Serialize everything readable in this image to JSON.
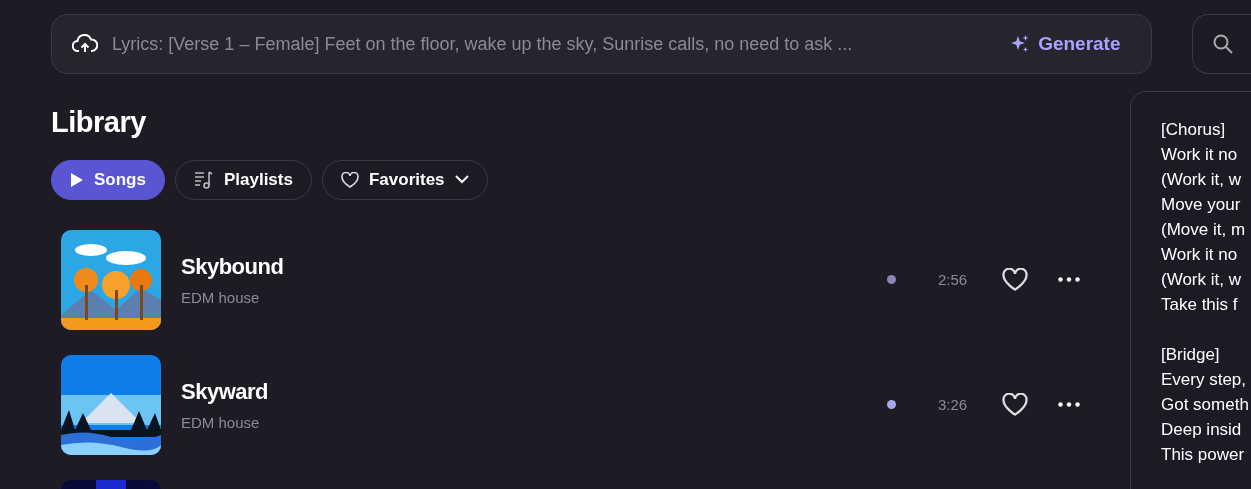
{
  "prompt_bar": {
    "placeholder": "Lyrics: [Verse 1 – Female] Feet on the floor, wake up the sky, Sunrise calls, no need to ask ...",
    "generate_label": "Generate"
  },
  "library": {
    "title": "Library",
    "tabs": [
      {
        "label": "Songs",
        "kind": "play",
        "selected": true
      },
      {
        "label": "Playlists",
        "kind": "playlist",
        "selected": false
      },
      {
        "label": "Favorites",
        "kind": "dropdown",
        "selected": false
      }
    ],
    "songs": [
      {
        "kind": "song",
        "title": "Skybound",
        "genre": "EDM house",
        "duration": "2:56",
        "color": "#8a87b8"
      },
      {
        "kind": "song",
        "title": "Skyward",
        "genre": "EDM house",
        "duration": "3:26",
        "color": "#a7a5ee"
      },
      {
        "kind": "picture"
      }
    ]
  },
  "lyrics_panel": {
    "stanzas": [
      [
        "[Chorus]",
        "Work it no",
        "(Work it, w",
        "Move your",
        "(Move it, m",
        "Work it no",
        "(Work it, w",
        "Take this f"
      ],
      [
        "[Bridge]",
        "Every step,",
        "Got someth",
        "Deep insid",
        "This power"
      ]
    ]
  }
}
